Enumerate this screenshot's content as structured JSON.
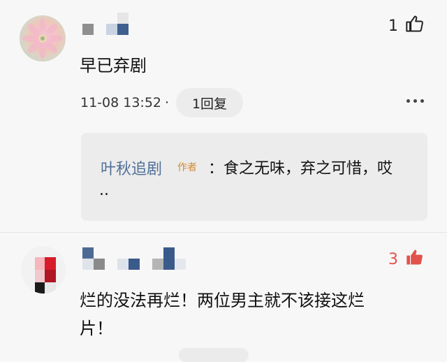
{
  "comments": [
    {
      "likes": "1",
      "text": "早已弃剧",
      "timestamp": "11-08 13:52",
      "dot": "·",
      "reply_count_label": "1回复",
      "reply": {
        "author": "叶秋追剧",
        "badge": "作者",
        "text_line1": "：食之无味，弃之可惜，哎",
        "text_line2": ".."
      }
    },
    {
      "likes": "3",
      "text_line1": "烂的没法再烂！两位男主就不该接这烂",
      "text_line2": "片！"
    }
  ],
  "colors": {
    "like_active": "#e2524b",
    "author_link": "#4f6f99",
    "author_badge": "#d48a30"
  },
  "icons": {
    "like_outline": "thumbs-up-outline-icon",
    "like_filled": "thumbs-up-filled-icon",
    "more": "more-dots-icon"
  }
}
